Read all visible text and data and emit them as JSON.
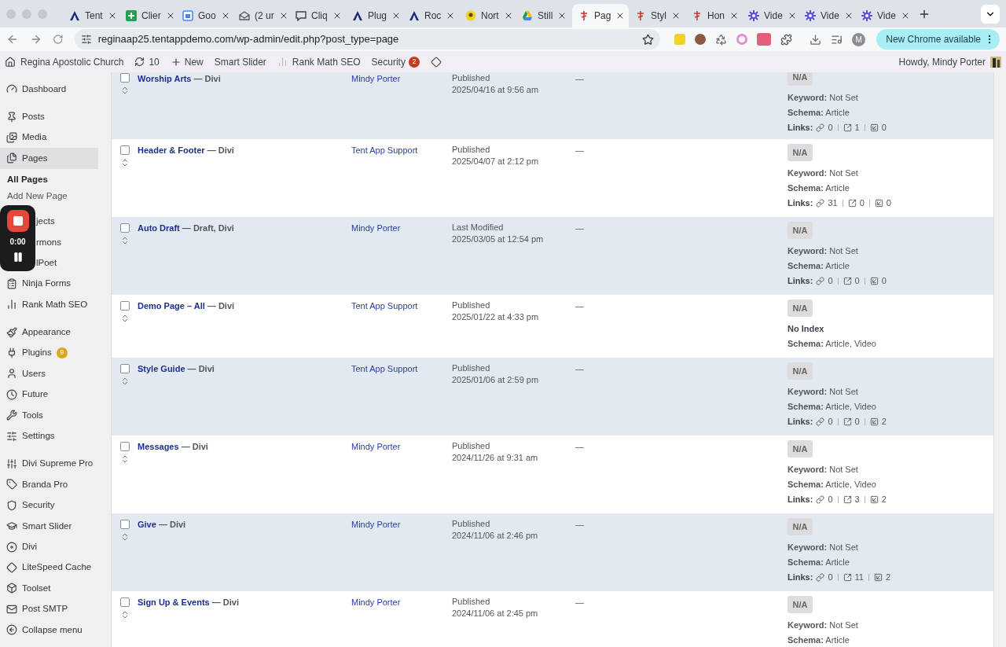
{
  "browser": {
    "tabs": [
      {
        "title": "Tent",
        "kind": "triangle",
        "selected": false
      },
      {
        "title": "Clier",
        "kind": "sheet",
        "selected": false
      },
      {
        "title": "Goo",
        "kind": "calendar",
        "selected": false
      },
      {
        "title": "(2 ur",
        "kind": "mail",
        "selected": false
      },
      {
        "title": "Cliq",
        "kind": "chat",
        "selected": false
      },
      {
        "title": "Plug",
        "kind": "triangle",
        "selected": false
      },
      {
        "title": "Roc",
        "kind": "triangle",
        "selected": false
      },
      {
        "title": "Nort",
        "kind": "coin",
        "selected": false
      },
      {
        "title": "Still",
        "kind": "drive",
        "selected": false
      },
      {
        "title": "Pag",
        "kind": "cross",
        "selected": true
      },
      {
        "title": "Styl",
        "kind": "cross",
        "selected": false
      },
      {
        "title": "Hon",
        "kind": "cross",
        "selected": false
      },
      {
        "title": "Vide",
        "kind": "flower",
        "selected": false
      },
      {
        "title": "Vide",
        "kind": "flower",
        "selected": false
      },
      {
        "title": "Vide",
        "kind": "flower",
        "selected": false
      }
    ],
    "url": "reginaap25.tentappdemo.com/wp-admin/edit.php?post_type=page",
    "profile_initial": "M",
    "update_button": "New Chrome available"
  },
  "admin_bar": {
    "site": "Regina Apostolic Church",
    "updates": "10",
    "new": "New",
    "smart_slider": "Smart Slider",
    "rank_math": "Rank Math SEO",
    "security": "Security",
    "security_count": "2",
    "greeting": "Howdy, Mindy Porter"
  },
  "sidebar": {
    "sections": [
      {
        "items": [
          {
            "label": "Dashboard",
            "kind": "gauge",
            "selected": false
          }
        ]
      },
      {
        "items": [
          {
            "label": "Posts",
            "kind": "pin",
            "selected": false
          },
          {
            "label": "Media",
            "kind": "media",
            "selected": false
          },
          {
            "label": "Pages",
            "kind": "pages",
            "selected": true,
            "children": [
              {
                "label": "All Pages",
                "selected": true
              },
              {
                "label": "Add New Page",
                "selected": false
              }
            ]
          },
          {
            "label": "jects",
            "kind": "hidden",
            "selected": false
          },
          {
            "label": "rmons",
            "kind": "hidden",
            "selected": false
          },
          {
            "label": "lPoet",
            "kind": "hidden",
            "selected": false
          },
          {
            "label": "Ninja Forms",
            "kind": "forms",
            "selected": false
          },
          {
            "label": "Rank Math SEO",
            "kind": "chart",
            "selected": false
          }
        ]
      },
      {
        "items": [
          {
            "label": "Appearance",
            "kind": "brush",
            "selected": false
          },
          {
            "label": "Plugins",
            "kind": "plug",
            "selected": false,
            "badge": "9"
          },
          {
            "label": "Users",
            "kind": "user",
            "selected": false
          },
          {
            "label": "Future",
            "kind": "clock",
            "selected": false
          },
          {
            "label": "Tools",
            "kind": "wrench",
            "selected": false
          },
          {
            "label": "Settings",
            "kind": "settings",
            "selected": false
          }
        ]
      },
      {
        "items": [
          {
            "label": "Divi Supreme Pro",
            "kind": "supreme",
            "selected": false
          },
          {
            "label": "Branda Pro",
            "kind": "tag",
            "selected": false
          },
          {
            "label": "Security",
            "kind": "shield",
            "selected": false
          },
          {
            "label": "Smart Slider",
            "kind": "cap",
            "selected": false
          },
          {
            "label": "Divi",
            "kind": "disc",
            "selected": false
          },
          {
            "label": "LiteSpeed Cache",
            "kind": "diamond",
            "selected": false
          },
          {
            "label": "Toolset",
            "kind": "box",
            "selected": false
          },
          {
            "label": "Post SMTP",
            "kind": "mail",
            "selected": false
          },
          {
            "label": "Collapse menu",
            "kind": "collapse",
            "selected": false
          }
        ]
      }
    ]
  },
  "recorder": {
    "time": "0:00"
  },
  "table": {
    "rows": [
      {
        "title": "Worship Arts",
        "state": " — Divi",
        "checked": false,
        "author": "Mindy Porter",
        "status": "Published",
        "date": "2025/04/16 at 9:56 am",
        "column_4": "—",
        "seo_score": "N/A",
        "keyword": "**Keyword:** Not Set",
        "schema": "**Schema:** Article",
        "links": {
          "label": "Links:",
          "internal": "0",
          "external": "1",
          "incoming": "0"
        }
      },
      {
        "title": "Header & Footer",
        "state": " — Divi",
        "checked": false,
        "author": "Tent App Support",
        "status": "Published",
        "date": "2025/04/07 at 2:12 pm",
        "column_4": "—",
        "seo_score": "N/A",
        "keyword": "**Keyword:** Not Set",
        "schema": "**Schema:** Article",
        "links": {
          "label": "Links:",
          "internal": "31",
          "external": "0",
          "incoming": "0"
        }
      },
      {
        "title": "Auto Draft",
        "state": " — Draft, Divi",
        "checked": false,
        "author": "Mindy Porter",
        "status": "Last Modified",
        "date": "2025/03/05 at 12:54 pm",
        "column_4": "—",
        "seo_score": "N/A",
        "keyword": "**Keyword:** Not Set",
        "schema": "**Schema:** Article",
        "links": {
          "label": "Links:",
          "internal": "0",
          "external": "0",
          "incoming": "0"
        }
      },
      {
        "title": "Demo Page – All",
        "state": " — Divi",
        "checked": false,
        "author": "Tent App Support",
        "status": "Published",
        "date": "2025/01/22 at 4:33 pm",
        "column_4": "—",
        "seo_score": "N/A",
        "no_index": "No Index",
        "schema": "**Schema:** Article, Video"
      },
      {
        "title": "Style Guide",
        "state": " — Divi",
        "checked": false,
        "author": "Tent App Support",
        "status": "Published",
        "date": "2025/01/06 at 2:59 pm",
        "column_4": "—",
        "seo_score": "N/A",
        "keyword": "**Keyword:** Not Set",
        "schema": "**Schema:** Article, Video",
        "links": {
          "label": "Links:",
          "internal": "0",
          "external": "0",
          "incoming": "2"
        }
      },
      {
        "title": "Messages",
        "state": " — Divi",
        "checked": false,
        "author": "Mindy Porter",
        "status": "Published",
        "date": "2024/11/26 at 9:31 am",
        "column_4": "—",
        "seo_score": "N/A",
        "keyword": "**Keyword:** Not Set",
        "schema": "**Schema:** Article, Video",
        "links": {
          "label": "Links:",
          "internal": "0",
          "external": "3",
          "incoming": "2"
        }
      },
      {
        "title": "Give",
        "state": " — Divi",
        "checked": false,
        "author": "Mindy Porter",
        "status": "Published",
        "date": "2024/11/06 at 2:46 pm",
        "column_4": "—",
        "seo_score": "N/A",
        "keyword": "**Keyword:** Not Set",
        "schema": "**Schema:** Article",
        "links": {
          "label": "Links:",
          "internal": "0",
          "external": "11",
          "incoming": "2"
        }
      },
      {
        "title": "Sign Up & Events",
        "state": " — Divi",
        "checked": false,
        "author": "Mindy Porter",
        "status": "Published",
        "date": "2024/11/06 at 2:45 pm",
        "column_4": "—",
        "seo_score": "N/A",
        "keyword": "**Keyword:** Not Set",
        "schema": "**Schema:** Article"
      }
    ]
  }
}
